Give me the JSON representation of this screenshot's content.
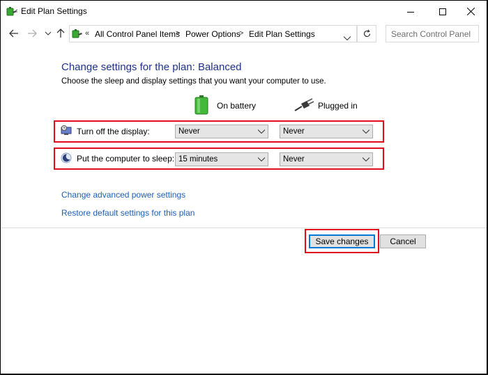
{
  "window": {
    "title": "Edit Plan Settings",
    "controls": {
      "minimize": "minimize",
      "maximize": "maximize",
      "close": "close"
    }
  },
  "address_bar": {
    "overflow": "«",
    "breadcrumbs": [
      "All Control Panel Items",
      "Power Options",
      "Edit Plan Settings"
    ],
    "separator": ">",
    "search_placeholder": "Search Control Panel"
  },
  "main": {
    "heading": "Change settings for the plan: Balanced",
    "subtext": "Choose the sleep and display settings that you want your computer to use.",
    "columns": {
      "battery": "On battery",
      "plugged": "Plugged in"
    },
    "settings": [
      {
        "label": "Turn off the display:",
        "battery": "Never",
        "plugged": "Never"
      },
      {
        "label": "Put the computer to sleep:",
        "battery": "15 minutes",
        "plugged": "Never"
      }
    ],
    "links": [
      "Change advanced power settings",
      "Restore default settings for this plan"
    ]
  },
  "buttons": {
    "save": "Save changes",
    "cancel": "Cancel"
  },
  "colors": {
    "heading": "#1e3287",
    "link": "#1e5fb4",
    "highlight": "#e20d1a"
  }
}
